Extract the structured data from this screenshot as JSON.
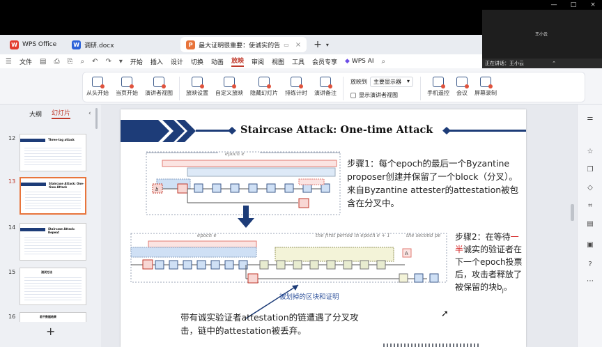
{
  "window": {
    "controls": [
      "—",
      "□",
      "×"
    ]
  },
  "speaker": {
    "name": "王小云",
    "status": "正在讲话：王小云"
  },
  "tabs": [
    {
      "label": "WPS Office",
      "logo": "W",
      "logo_color": "#e33b2e"
    },
    {
      "label": "调研.docx",
      "logo": "W",
      "logo_color": "#2b62d9"
    },
    {
      "label": "最大证明很重要：使诚实的告",
      "logo": "P",
      "logo_color": "#e8743b",
      "active": true
    }
  ],
  "menu": {
    "file": "文件",
    "items": [
      "开始",
      "插入",
      "设计",
      "切换",
      "动画",
      "放映",
      "审阅",
      "视图",
      "工具",
      "会员专享"
    ],
    "active": "放映",
    "ai": "WPS AI"
  },
  "ribbon": {
    "buttons1": [
      "从头开始",
      "当页开始",
      "演讲者视图"
    ],
    "buttons2": [
      "放映设置",
      "自定义放映",
      "隐藏幻灯片",
      "排练计时",
      "演讲备注"
    ],
    "play_to_label": "放映到",
    "play_to_value": "主要显示器",
    "show_presenter": "显示演讲者视图",
    "buttons3": [
      "手机遥控",
      "会议",
      "屏幕录制"
    ]
  },
  "left_panel": {
    "tabs": [
      "大纲",
      "幻灯片"
    ],
    "active_tab": "幻灯片",
    "slides": [
      {
        "num": "12",
        "title": "Three-tag attack"
      },
      {
        "num": "13",
        "title": "Staircase Attack: One-time Attack",
        "selected": true
      },
      {
        "num": "14",
        "title": "Staircase Attack: Repeat"
      },
      {
        "num": "15",
        "title": "测试方法"
      },
      {
        "num": "16",
        "title": "若干数据结果"
      }
    ],
    "add": "+"
  },
  "slide": {
    "title": "Staircase Attack: One-time Attack",
    "step1": "步骤1：每个epoch的最后一个Byzantine proposer创建并保留了一个block（分叉）。来自Byzantine attester的attestation被包含在分叉中。",
    "step2_a": "步骤2：在等待",
    "step2_red": "一半",
    "step2_b": "诚实的验证者在下一个epoch投票后，攻击者释放了被保留的块b",
    "step2_sub": "j",
    "step2_end": "。",
    "caption": "被划掉的区块和证明",
    "bottom_note": "带有诚实验证者attestation的链遭遇了分叉攻击，链中的attestation被丢弃。",
    "diagram": {
      "epoch_label_top": "epoch e",
      "epoch_label_bottom": "epoch e",
      "first_period": "the first period in epoch e + 1",
      "second_period": "the second pe",
      "bi": "b",
      "bi_sub": "i",
      "bj": "b",
      "bj_sub": "j",
      "A": "A"
    }
  },
  "colors": {
    "accent": "#c0392b",
    "navy": "#1d3c78",
    "block_blue": "#cfe0f5",
    "block_red": "#f8d7d4",
    "link": "#2b4f9a"
  },
  "right_icons": [
    "sliders-icon",
    "star-icon",
    "copy-icon",
    "shapes-icon",
    "crop-icon",
    "layers-icon",
    "image-icon",
    "help-icon",
    "more-icon"
  ]
}
